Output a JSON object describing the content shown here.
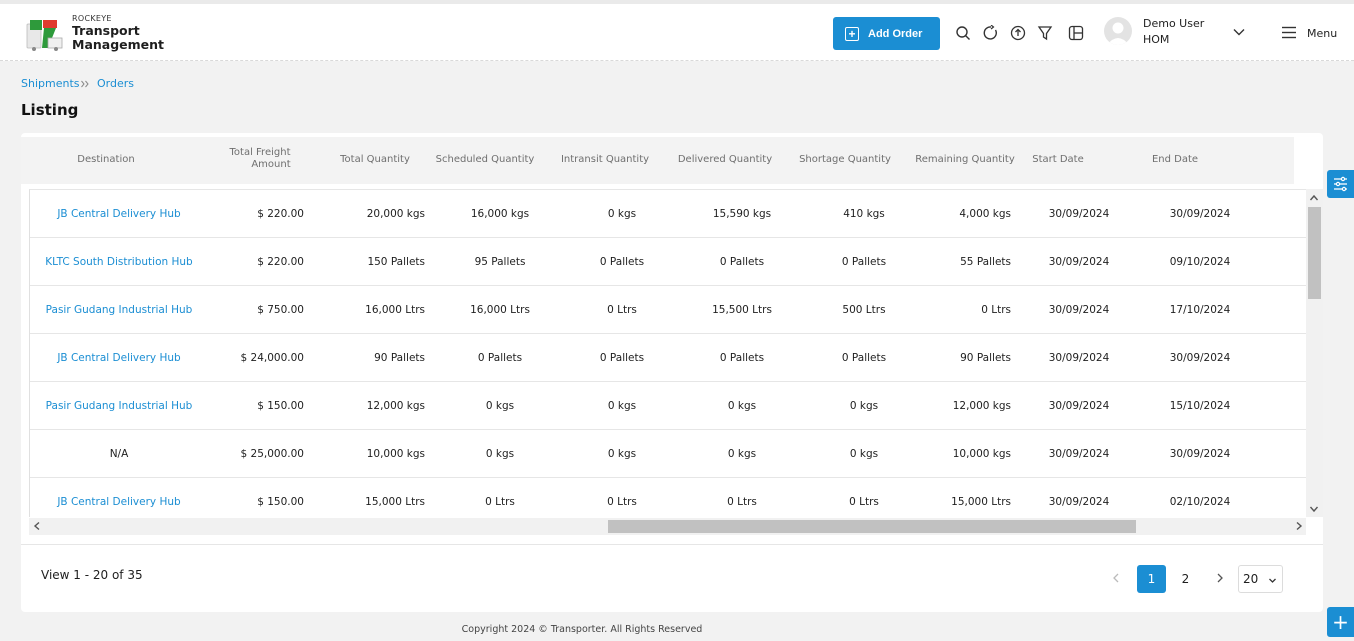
{
  "brand": {
    "small": "ROCKEYE",
    "line1": "Transport",
    "line2": "Management"
  },
  "header": {
    "add_order": "Add Order",
    "user_name": "Demo User",
    "user_org": "HOM",
    "menu_label": "Menu",
    "icons": [
      "search-icon",
      "refresh-icon",
      "upload-icon",
      "filter-icon",
      "columns-icon"
    ]
  },
  "breadcrumb": {
    "item1": "Shipments",
    "item2": "Orders"
  },
  "page_title": "Listing",
  "table": {
    "headers": {
      "destination": "Destination",
      "freight_line1": "Total Freight",
      "freight_line2": "Amount",
      "total_qty": "Total Quantity",
      "scheduled_qty": "Scheduled Quantity",
      "intransit_qty": "Intransit Quantity",
      "delivered_qty": "Delivered Quantity",
      "shortage_qty": "Shortage Quantity",
      "remaining_qty": "Remaining Quantity",
      "start_date": "Start Date",
      "end_date": "End Date"
    },
    "rows": [
      {
        "destination": "JB Central Delivery Hub",
        "is_link": true,
        "freight": "$ 220.00",
        "total": "20,000 kgs",
        "scheduled": "16,000 kgs",
        "intransit": "0 kgs",
        "delivered": "15,590 kgs",
        "shortage": "410 kgs",
        "remaining": "4,000 kgs",
        "start": "30/09/2024",
        "end": "30/09/2024"
      },
      {
        "destination": "KLTC South Distribution Hub",
        "is_link": true,
        "freight": "$ 220.00",
        "total": "150 Pallets",
        "scheduled": "95 Pallets",
        "intransit": "0 Pallets",
        "delivered": "0 Pallets",
        "shortage": "0 Pallets",
        "remaining": "55 Pallets",
        "start": "30/09/2024",
        "end": "09/10/2024"
      },
      {
        "destination": "Pasir Gudang Industrial Hub",
        "is_link": true,
        "freight": "$ 750.00",
        "total": "16,000 Ltrs",
        "scheduled": "16,000 Ltrs",
        "intransit": "0 Ltrs",
        "delivered": "15,500 Ltrs",
        "shortage": "500 Ltrs",
        "remaining": "0 Ltrs",
        "start": "30/09/2024",
        "end": "17/10/2024"
      },
      {
        "destination": "JB Central Delivery Hub",
        "is_link": true,
        "freight": "$ 24,000.00",
        "total": "90 Pallets",
        "scheduled": "0 Pallets",
        "intransit": "0 Pallets",
        "delivered": "0 Pallets",
        "shortage": "0 Pallets",
        "remaining": "90 Pallets",
        "start": "30/09/2024",
        "end": "30/09/2024"
      },
      {
        "destination": "Pasir Gudang Industrial Hub",
        "is_link": true,
        "freight": "$ 150.00",
        "total": "12,000 kgs",
        "scheduled": "0 kgs",
        "intransit": "0 kgs",
        "delivered": "0 kgs",
        "shortage": "0 kgs",
        "remaining": "12,000 kgs",
        "start": "30/09/2024",
        "end": "15/10/2024"
      },
      {
        "destination": "N/A",
        "is_link": false,
        "freight": "$ 25,000.00",
        "total": "10,000 kgs",
        "scheduled": "0 kgs",
        "intransit": "0 kgs",
        "delivered": "0 kgs",
        "shortage": "0 kgs",
        "remaining": "10,000 kgs",
        "start": "30/09/2024",
        "end": "30/09/2024"
      },
      {
        "destination": "JB Central Delivery Hub",
        "is_link": true,
        "freight": "$ 150.00",
        "total": "15,000 Ltrs",
        "scheduled": "0 Ltrs",
        "intransit": "0 Ltrs",
        "delivered": "0 Ltrs",
        "shortage": "0 Ltrs",
        "remaining": "15,000 Ltrs",
        "start": "30/09/2024",
        "end": "02/10/2024"
      }
    ]
  },
  "pagination": {
    "view_text": "View 1 - 20 of 35",
    "page1": "1",
    "page2": "2",
    "page_size": "20"
  },
  "footer": "Copyright 2024 © Transporter. All Rights Reserved",
  "colors": {
    "accent": "#1b8ed3",
    "page_bg": "#f2f2f2",
    "header_bg": "#f3f3f3"
  }
}
